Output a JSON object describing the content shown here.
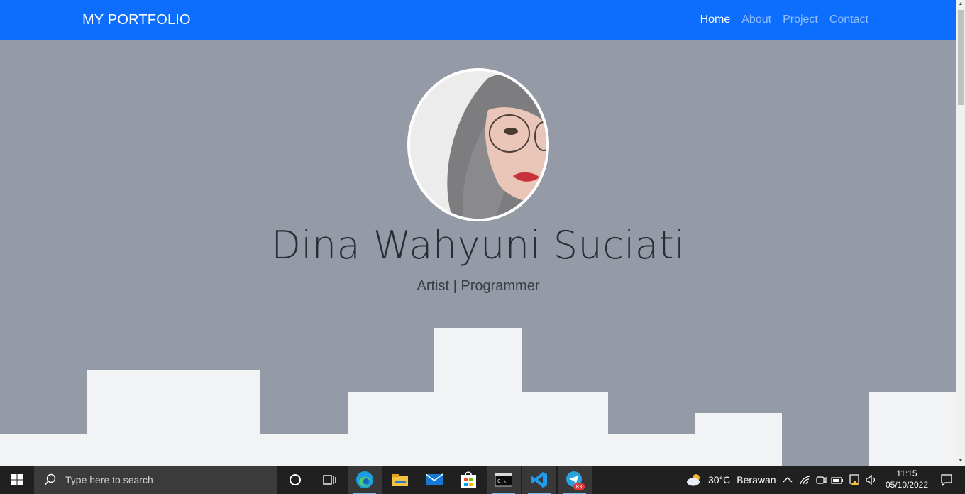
{
  "navbar": {
    "brand": "MY PORTFOLIO",
    "links": [
      {
        "label": "Home",
        "active": true
      },
      {
        "label": "About",
        "active": false
      },
      {
        "label": "Project",
        "active": false
      },
      {
        "label": "Contact",
        "active": false
      }
    ]
  },
  "hero": {
    "name": "Dina Wahyuni Suciati",
    "tagline": "Artist | Programmer"
  },
  "taskbar": {
    "search_placeholder": "Type here to search",
    "apps": [
      "cortana-icon",
      "task-view-icon",
      "edge-icon",
      "file-explorer-icon",
      "mail-icon",
      "store-icon",
      "terminal-icon",
      "vscode-icon",
      "telegram-icon"
    ],
    "telegram_badge": "83",
    "weather_temp": "30°C",
    "weather_desc": "Berawan",
    "time": "11:15",
    "date": "05/10/2022"
  },
  "colors": {
    "navbar": "#0d6efd",
    "hero_bg": "#949aa6",
    "skyline": "#f1f3f5",
    "taskbar": "#202020"
  }
}
